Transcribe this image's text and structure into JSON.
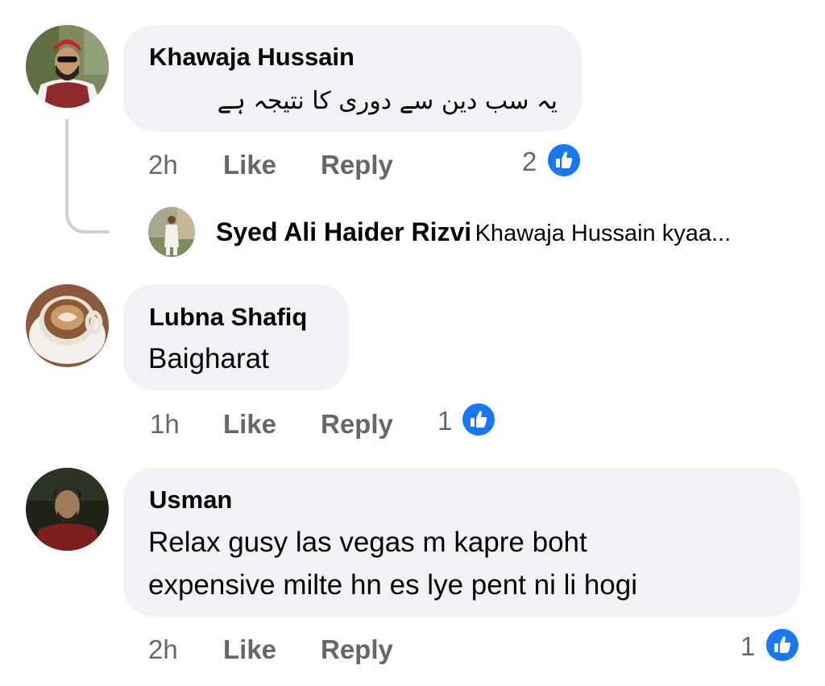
{
  "comments": [
    {
      "author": "Khawaja Hussain",
      "text": "یہ سب دین سے دوری کا نتیجہ ہے",
      "time": "2h",
      "like_label": "Like",
      "reply_label": "Reply",
      "reaction_count": "2",
      "reply_preview": {
        "author": "Syed Ali Haider Rizvi",
        "snippet": "Khawaja Hussain kyaa..."
      }
    },
    {
      "author": "Lubna Shafiq",
      "text": "Baigharat",
      "time": "1h",
      "like_label": "Like",
      "reply_label": "Reply",
      "reaction_count": "1"
    },
    {
      "author": "Usman",
      "text_lines": [
        "Relax gusy las vegas m kapre boht",
        "expensive milte hn es lye pent ni li hogi"
      ],
      "time": "2h",
      "like_label": "Like",
      "reply_label": "Reply",
      "reaction_count": "1"
    }
  ],
  "colors": {
    "bubble": "#f0f2f5",
    "meta_text": "#65676b",
    "like_blue": "#1877f2",
    "thread_line": "#ced0d4"
  },
  "icons": {
    "reaction": "like-thumbs-up-icon"
  }
}
